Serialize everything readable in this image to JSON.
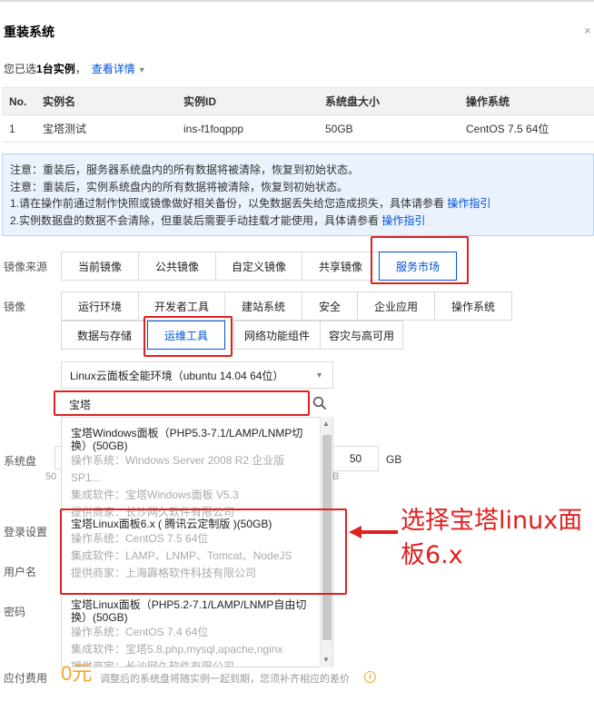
{
  "dialog": {
    "title": "重装系统",
    "close": "×"
  },
  "selected": {
    "prefix": "您已选",
    "count": "1台实例",
    "suffix": "，",
    "view_details": "查看详情",
    "caret": "▼"
  },
  "instance_table": {
    "headers": [
      "No.",
      "实例名",
      "实例ID",
      "系统盘大小",
      "操作系统"
    ],
    "rows": [
      [
        "1",
        "宝塔测试",
        "ins-f1foqppp",
        "50GB",
        "CentOS 7.5 64位"
      ]
    ]
  },
  "notice": {
    "line1": "注意：重装后，服务器系统盘内的所有数据将被清除，恢复到初始状态。",
    "line2": "注意：重装后，实例系统盘内的所有数据将被清除，恢复到初始状态。",
    "line3": "1.请在操作前通过制作快照或镜像做好相关备份，以免数据丢失给您造成损失，具体请参看",
    "line3_link": "操作指引",
    "line4": "2.实例数据盘的数据不会清除，但重装后需要手动挂载才能使用，具体请参看",
    "line4_link": "操作指引"
  },
  "image_source": {
    "label": "镜像来源",
    "options": [
      "当前镜像",
      "公共镜像",
      "自定义镜像",
      "共享镜像",
      "服务市场"
    ],
    "selected": "服务市场"
  },
  "image_category": {
    "label": "镜像",
    "row1": [
      "运行环境",
      "开发者工具",
      "建站系统",
      "安全",
      "企业应用",
      "操作系统"
    ],
    "row2": [
      "数据与存储",
      "运维工具",
      "网络功能组件",
      "容灾与高可用"
    ],
    "selected": "运维工具"
  },
  "image_select": {
    "value": "Linux云面板全能环境（ubuntu 14.04 64位）",
    "caret": "▼"
  },
  "search": {
    "value": "宝塔"
  },
  "results": [
    {
      "title": "宝塔Windows面板（PHP5.3-7.1/LAMP/LNMP切换）(50GB)",
      "os": "操作系统：Windows Server 2008 R2 企业版 SP1...",
      "software": "集成软件：宝塔Windows面板 V5.3",
      "vendor": "提供商家：长沙网久软件有限公司"
    },
    {
      "title": "宝塔Linux面板6.x ( 腾讯云定制版 )(50GB)",
      "os": "操作系统：CentOS 7.5 64位",
      "software": "集成软件：LAMP、LNMP、Tomcat、NodeJS",
      "vendor": "提供商家：上海霹格软件科技有限公司"
    },
    {
      "title": "宝塔Linux面板（PHP5.2-7.1/LAMP/LNMP自由切换）(50GB)",
      "os": "操作系统：CentOS 7.4 64位",
      "software": "集成软件：宝塔5.8,php,mysql,apache,nginx",
      "vendor": "提供商家：长沙网久软件有限公司"
    }
  ],
  "system_disk": {
    "label": "系统盘",
    "value": "50",
    "unit": "GB",
    "peek_left": "50",
    "peek_right": "B"
  },
  "login": {
    "label": "登录设置"
  },
  "username": {
    "label": "用户名"
  },
  "password": {
    "label": "密码"
  },
  "fee": {
    "label": "应付费用",
    "amount": "0元",
    "note": "调整后的系统盘将随实例一起到期，您须补齐相应的差价",
    "info": "i"
  },
  "annotation": {
    "line1": "选择宝塔linux面",
    "line2": "板6.x"
  }
}
